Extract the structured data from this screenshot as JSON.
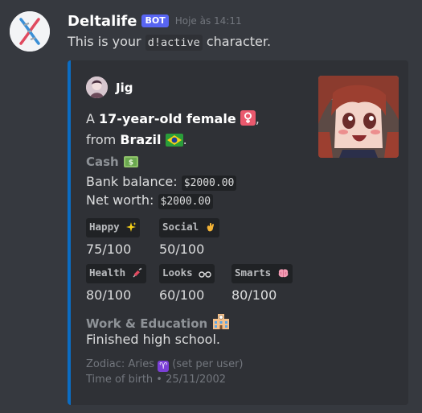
{
  "message": {
    "username": "Deltalife",
    "bot_tag": "BOT",
    "timestamp": "Hoje às 14:11",
    "text_before": "This is your ",
    "command": "d!active",
    "text_after": " character."
  },
  "embed": {
    "accent_color": "#0b6dc4",
    "author": "Jig",
    "desc_line1_prefix": "A ",
    "desc_line1_bold": "17-year-old female",
    "desc_line1_suffix": ",",
    "desc_line2_prefix": "from ",
    "desc_line2_bold": "Brazil",
    "desc_line2_suffix": ".",
    "cash": {
      "title": "Cash",
      "bank_label": "Bank balance: ",
      "bank_value": "$2000.00",
      "net_label": "Net worth: ",
      "net_value": "$2000.00"
    },
    "stats": [
      {
        "label": "Happy",
        "value": "75/100",
        "icon": "sparkles-icon"
      },
      {
        "label": "Social",
        "value": "50/100",
        "icon": "waving-hand-icon"
      },
      {
        "label": "Health",
        "value": "80/100",
        "icon": "syringe-icon"
      },
      {
        "label": "Looks",
        "value": "60/100",
        "icon": "glasses-icon"
      },
      {
        "label": "Smarts",
        "value": "80/100",
        "icon": "brain-icon"
      }
    ],
    "work": {
      "title": "Work & Education",
      "value": "Finished high school."
    },
    "footer": {
      "zodiac_prefix": "Zodiac: Aries",
      "zodiac_symbol": "♈",
      "zodiac_suffix": "(set per user)",
      "birth_label": "Time of birth",
      "birth_sep": "•",
      "birth_value": "25/11/2002"
    }
  }
}
